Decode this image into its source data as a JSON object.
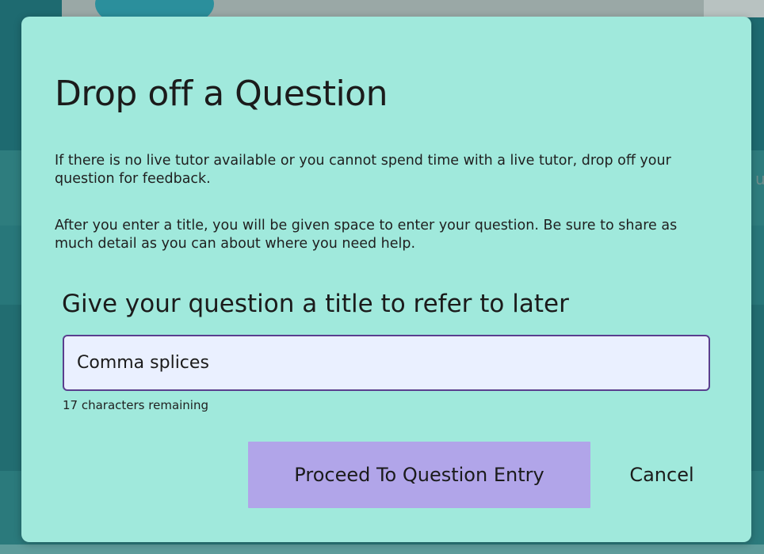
{
  "modal": {
    "title": "Drop off a Question",
    "paragraph_1": "If there is no live tutor available or you cannot spend time with a live tutor, drop off your question for feedback.",
    "paragraph_2": "After you enter a title, you will be given space to enter your question. Be sure to share as much detail as you can about where you need help.",
    "field_label": "Give your question a title to refer to later",
    "title_input": {
      "value": "Comma splices"
    },
    "characters_remaining": "17 characters remaining",
    "proceed_label": "Proceed To Question Entry",
    "cancel_label": "Cancel"
  },
  "background": {
    "partial_letter": "u"
  },
  "colors": {
    "modal_bg": "#a0e9dc",
    "input_bg": "#eaf0ff",
    "input_border": "#5a3f8e",
    "proceed_bg": "#b1a5e9",
    "page_bg": "#1b5d63"
  }
}
